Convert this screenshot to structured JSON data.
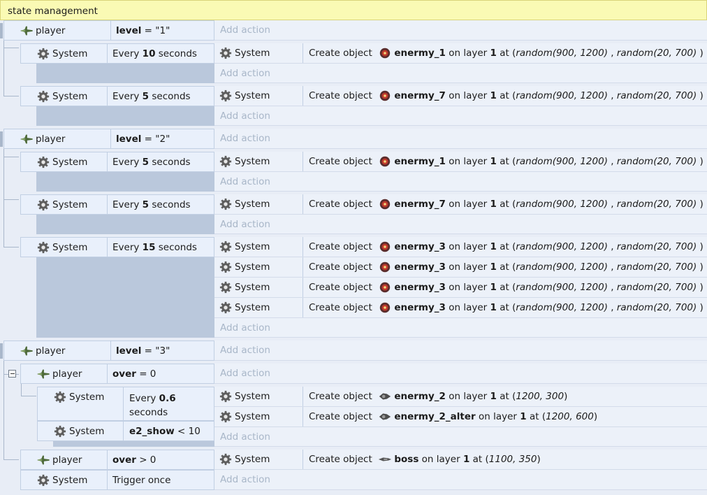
{
  "header": {
    "title": "state management"
  },
  "add_action": "Add action",
  "objects": {
    "player": "player",
    "system": "System",
    "create": "Create object",
    "on_layer": "on layer",
    "at": "at",
    "one": "1",
    "every": "Every",
    "seconds": "seconds",
    "random_x": "random(900,  1200)",
    "random_y": "random(20,  700)"
  },
  "level_var": "level",
  "over_var": "over",
  "e2_show_var": "e2_show",
  "ops": {
    "eq": "=",
    "gt": ">",
    "lt": "<"
  },
  "values": {
    "level1": "\"1\"",
    "level2": "\"2\"",
    "level3": "\"3\"",
    "zero": "0",
    "ten": "10",
    "n10": "10",
    "n5": "5",
    "n15": "15",
    "n06": "0.6"
  },
  "enemies": {
    "e1": "enermy_1",
    "e7": "enermy_7",
    "e3": "enermy_3",
    "e2": "enermy_2",
    "e2alt": "enermy_2_alter",
    "boss": "boss"
  },
  "coords": {
    "e2": "1200, 300",
    "e2alt": "1200, 600",
    "boss": "1100, 350"
  },
  "trigger_once": "Trigger once",
  "colors": {
    "header_bg": "#fafab4",
    "cond_bg": "#e9f0fb",
    "empty_bg": "#bac8dc",
    "action_bg": "#ecf1f9",
    "add_action": "#a8b6c8"
  },
  "icons": {
    "player": "plane-icon",
    "system": "gear-icon",
    "enemy": "enemy-sprite-icon",
    "collapse": "collapse-toggle-icon"
  }
}
